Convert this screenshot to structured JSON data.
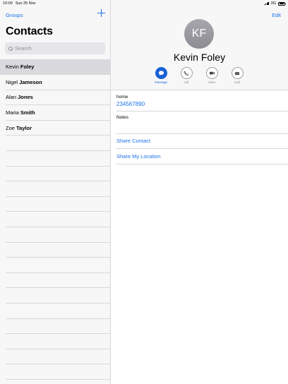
{
  "status_bar": {
    "time": "10:00",
    "date": "Sun 25 Nov",
    "network": "3G"
  },
  "sidebar": {
    "groups_label": "Groups",
    "title": "Contacts",
    "search_placeholder": "Search",
    "contacts": [
      {
        "first": "Kevin",
        "last": "Foley",
        "selected": true
      },
      {
        "first": "Nigel",
        "last": "Jameson",
        "selected": false
      },
      {
        "first": "Alan",
        "last": "Jones",
        "selected": false
      },
      {
        "first": "Maria",
        "last": "Smith",
        "selected": false
      },
      {
        "first": "Zoe",
        "last": "Taylor",
        "selected": false
      }
    ]
  },
  "detail": {
    "edit_label": "Edit",
    "initials": "KF",
    "name": "Kevin Foley",
    "actions": [
      {
        "label": "message",
        "icon": "message-icon",
        "primary": true
      },
      {
        "label": "call",
        "icon": "phone-icon",
        "primary": false
      },
      {
        "label": "video",
        "icon": "video-icon",
        "primary": false
      },
      {
        "label": "mail",
        "icon": "mail-icon",
        "primary": false
      }
    ],
    "phone_label": "home",
    "phone_value": "234567890",
    "notes_label": "Notes",
    "share_contact": "Share Contact",
    "share_location": "Share My Location"
  },
  "colors": {
    "accent": "#1a73e8",
    "action_primary": "#1a62d6",
    "avatar": "#9a9aa0"
  }
}
